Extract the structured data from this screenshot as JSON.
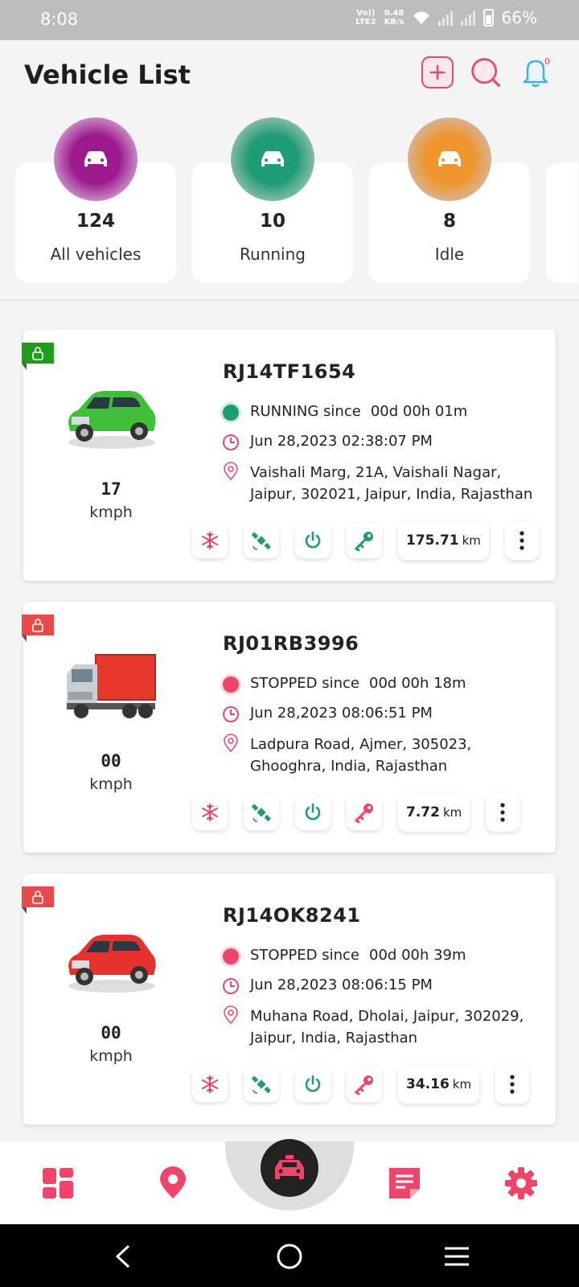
{
  "status_bar": {
    "time": "8:08",
    "network": "Vo)) LTE2",
    "speed": "0.48 KB/s",
    "battery": "66%"
  },
  "header": {
    "title": "Vehicle List",
    "notification_count": "0"
  },
  "summary": [
    {
      "count": "124",
      "label": "All vehicles",
      "color": "#9c1a8e",
      "ring": "#c585c2"
    },
    {
      "count": "10",
      "label": "Running",
      "color": "#1e9c74",
      "ring": "#7fb9a6"
    },
    {
      "count": "8",
      "label": "Idle",
      "color": "#f0952b",
      "ring": "#d9b18a"
    }
  ],
  "vehicles": [
    {
      "plate": "RJ14TF1654",
      "status": "RUNNING since",
      "duration": "00d 00h 01m",
      "status_color": "#1e9c74",
      "timestamp": "Jun 28,2023 02:38:07 PM",
      "address": "Vaishali Marg, 21A, Vaishali Nagar, Jaipur, 302021, Jaipur, India, Rajasthan",
      "speed": "17",
      "speed_unit": "kmph",
      "distance": "175.71",
      "distance_unit": "km",
      "type": "car",
      "body_color": "#3fbf3a",
      "lock_color": "#1e9c1e",
      "power_color": "#1e9c74",
      "key_color": "#1e9c74"
    },
    {
      "plate": "RJ01RB3996",
      "status": "STOPPED since",
      "duration": "00d 00h 18m",
      "status_color": "#f0456a",
      "timestamp": "Jun 28,2023 08:06:51 PM",
      "address": "Ladpura Road, Ajmer, 305023, Ghooghra, India, Rajasthan",
      "speed": "00",
      "speed_unit": "kmph",
      "distance": "7.72",
      "distance_unit": "km",
      "type": "truck",
      "body_color": "#e8382c",
      "lock_color": "#e84a4a",
      "power_color": "#1e9c74",
      "key_color": "#f0456a"
    },
    {
      "plate": "RJ14OK8241",
      "status": "STOPPED since",
      "duration": "00d 00h 39m",
      "status_color": "#f0456a",
      "timestamp": "Jun 28,2023 08:06:15 PM",
      "address": "Muhana Road, Dholai, Jaipur, 302029, Jaipur, India, Rajasthan",
      "speed": "00",
      "speed_unit": "kmph",
      "distance": "34.16",
      "distance_unit": "km",
      "type": "car",
      "body_color": "#e8302c",
      "lock_color": "#e84a4a",
      "power_color": "#1e9c74",
      "key_color": "#f0456a"
    }
  ],
  "icons": {
    "accent": "#f0456a",
    "ac": "snowflake-icon",
    "gps": "satellite-icon",
    "ignition": "power-icon",
    "key": "key-icon"
  },
  "bottom_nav": [
    "dashboard-icon",
    "location-pin-icon",
    "vehicle-list-icon",
    "reports-icon",
    "settings-icon"
  ]
}
